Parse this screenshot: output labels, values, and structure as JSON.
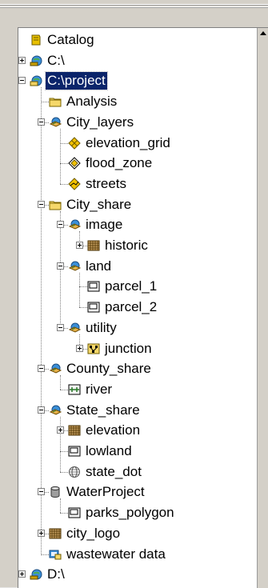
{
  "tree": {
    "items": [
      {
        "label": "Catalog",
        "icon": "catalog-icon",
        "depth": 0,
        "expander": "none"
      },
      {
        "label": "C:\\",
        "icon": "drive-icon",
        "depth": 0,
        "expander": "plus"
      },
      {
        "label": "C:\\project",
        "icon": "folder-connection-icon",
        "depth": 0,
        "expander": "minus",
        "selected": true
      },
      {
        "label": "Analysis",
        "icon": "folder-icon",
        "depth": 1,
        "expander": "none"
      },
      {
        "label": "City_layers",
        "icon": "feature-dataset-icon",
        "depth": 1,
        "expander": "minus"
      },
      {
        "label": "elevation_grid",
        "icon": "grid-layer-icon",
        "depth": 2,
        "expander": "none"
      },
      {
        "label": "flood_zone",
        "icon": "polygon-layer-icon",
        "depth": 2,
        "expander": "none"
      },
      {
        "label": "streets",
        "icon": "line-layer-icon",
        "depth": 2,
        "expander": "none"
      },
      {
        "label": "City_share",
        "icon": "folder-icon",
        "depth": 1,
        "expander": "minus"
      },
      {
        "label": "image",
        "icon": "feature-dataset-icon",
        "depth": 2,
        "expander": "minus"
      },
      {
        "label": "historic",
        "icon": "raster-icon",
        "depth": 3,
        "expander": "plus"
      },
      {
        "label": "land",
        "icon": "feature-dataset-icon",
        "depth": 2,
        "expander": "minus"
      },
      {
        "label": "parcel_1",
        "icon": "polygon-class-icon",
        "depth": 3,
        "expander": "none"
      },
      {
        "label": "parcel_2",
        "icon": "polygon-class-icon",
        "depth": 3,
        "expander": "none"
      },
      {
        "label": "utility",
        "icon": "feature-dataset-icon",
        "depth": 2,
        "expander": "minus"
      },
      {
        "label": "junction",
        "icon": "network-icon",
        "depth": 3,
        "expander": "plus"
      },
      {
        "label": "County_share",
        "icon": "feature-dataset-icon",
        "depth": 1,
        "expander": "minus"
      },
      {
        "label": "river",
        "icon": "line-class-icon",
        "depth": 2,
        "expander": "none"
      },
      {
        "label": "State_share",
        "icon": "feature-dataset-icon",
        "depth": 1,
        "expander": "minus"
      },
      {
        "label": "elevation",
        "icon": "raster-icon",
        "depth": 2,
        "expander": "plus"
      },
      {
        "label": "lowland",
        "icon": "polygon-class-icon",
        "depth": 2,
        "expander": "none"
      },
      {
        "label": "state_dot",
        "icon": "globe-icon",
        "depth": 2,
        "expander": "none"
      },
      {
        "label": "WaterProject",
        "icon": "database-icon",
        "depth": 1,
        "expander": "minus"
      },
      {
        "label": "parks_polygon",
        "icon": "polygon-class-icon",
        "depth": 2,
        "expander": "none"
      },
      {
        "label": "city_logo",
        "icon": "raster-icon",
        "depth": 1,
        "expander": "plus"
      },
      {
        "label": "wastewater data",
        "icon": "data-connection-icon",
        "depth": 1,
        "expander": "none"
      },
      {
        "label": "D:\\",
        "icon": "drive-icon",
        "depth": 0,
        "expander": "plus"
      }
    ]
  },
  "colors": {
    "selection": "#0a246a",
    "panel": "#d4d0c8",
    "tree_bg": "#ffffff",
    "dots": "#808080"
  }
}
